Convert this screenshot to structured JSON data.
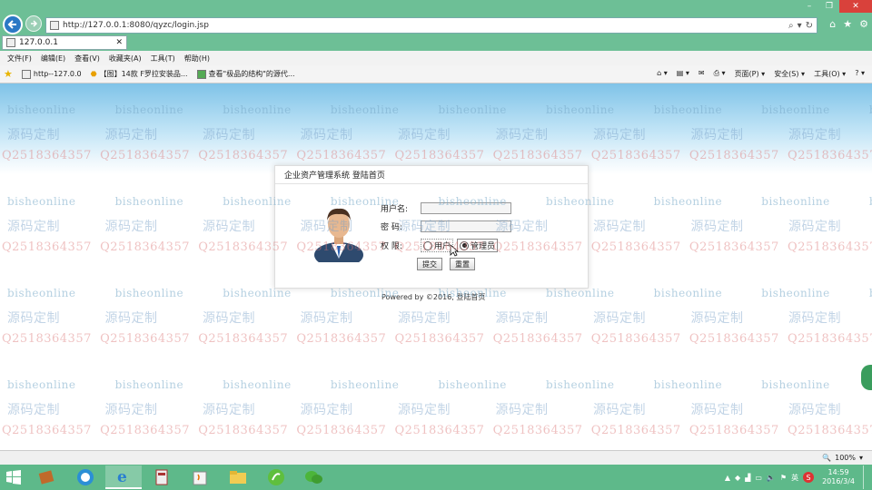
{
  "browser": {
    "address": "http://127.0.0.1:8080/qyzc/login.jsp",
    "tab_title": "127.0.0.1",
    "menus": [
      "文件(F)",
      "编辑(E)",
      "查看(V)",
      "收藏夹(A)",
      "工具(T)",
      "帮助(H)"
    ],
    "favorites": [
      "http--127.0.0",
      "【图】14款 F罗拉安装品...",
      "查看\"极品的结构\"的源代..."
    ],
    "commands": [
      "页面(P) ▾",
      "安全(S) ▾",
      "工具(O) ▾"
    ],
    "zoom": "100%"
  },
  "login": {
    "title": "企业资产管理系统 登陆首页",
    "username_label": "用户名:",
    "password_label": "密  码:",
    "role_label": "权  限:",
    "role_options": [
      "用户",
      "管理员"
    ],
    "selected_role": "管理员",
    "submit_label": "提交",
    "reset_label": "重置",
    "footer": "Powered by ©2016, 登陆首页"
  },
  "watermark": {
    "site": "bisheonline",
    "cn": "源码定制",
    "qq": "Q2518364357"
  },
  "taskbar": {
    "time": "14:59",
    "date": "2016/3/4"
  },
  "colors": {
    "chrome_green": "#6dbf96",
    "taskbar_green": "#5eb98a",
    "page_blue": "#7fc3e8"
  }
}
